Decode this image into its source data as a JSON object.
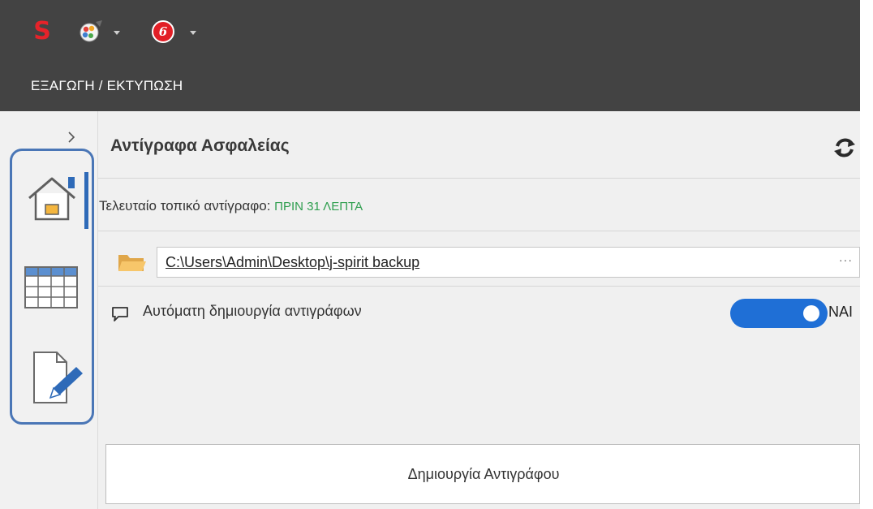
{
  "titlebar": {
    "menu_label": "ΕΞΑΓΩΓΗ / ΕΚΤΥΠΩΣΗ",
    "icons": [
      "app-s-logo-icon",
      "palette-icon",
      "circular-logo-icon"
    ],
    "background_color": "#434343"
  },
  "nav": {
    "items": [
      {
        "name": "home",
        "icon": "home-icon",
        "selected": true
      },
      {
        "name": "table",
        "icon": "table-grid-icon",
        "selected": false
      },
      {
        "name": "edit",
        "icon": "document-edit-icon",
        "selected": false
      }
    ],
    "highlight_color": "#4a76b6"
  },
  "panel": {
    "title": "Αντίγραφα Ασφαλείας",
    "last_backup_label": "Τελευταίο τοπικό αντίγραφο:",
    "last_backup_value": "ΠΡΙΝ 31 ΛΕΠΤΑ",
    "backup_path": "C:\\Users\\Admin\\Desktop\\j-spirit backup",
    "browse_dots": "···",
    "auto_backup_label": "Αυτόματη δημιουργία αντιγράφων",
    "auto_backup_toggle_on": true,
    "auto_backup_toggle_label": "ΝΑΙ",
    "create_button_label": "Δημιουργία Αντιγράφου"
  },
  "colors": {
    "accent": "#1f6fd6",
    "status_green": "#2e9e4e",
    "logo_red": "#e5232a"
  }
}
